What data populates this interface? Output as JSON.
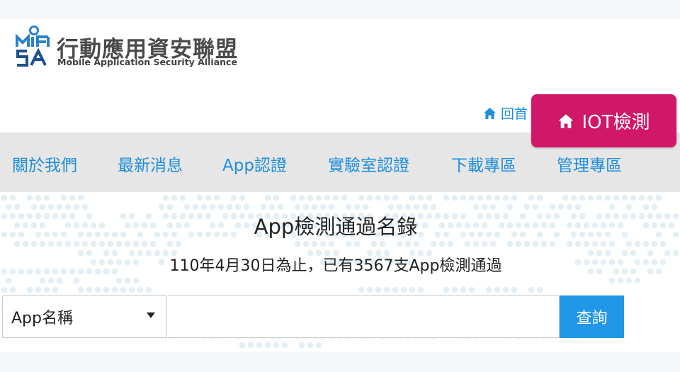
{
  "header": {
    "org_name": "行動應用資安聯盟",
    "org_subtitle": "Mobile Application Security Alliance",
    "home_link": "回首",
    "iot_button": "IOT檢測"
  },
  "nav": {
    "items": [
      {
        "label": "關於我們"
      },
      {
        "label": "最新消息"
      },
      {
        "label": "App認證"
      },
      {
        "label": "實驗室認證"
      },
      {
        "label": "下載專區"
      },
      {
        "label": "管理專區"
      }
    ]
  },
  "main": {
    "title": "App檢測通過名錄",
    "subtitle": "110年4月30日為止，已有3567支App檢測通過"
  },
  "search": {
    "select_value": "App名稱",
    "input_value": "",
    "button_label": "查詢"
  },
  "colors": {
    "brand_blue": "#1f8ed9",
    "iot_pink": "#d01768",
    "nav_bg": "#e6e6e6",
    "search_button": "#2196e6"
  },
  "icons": {
    "home": "home-icon",
    "caret": "caret-down-icon",
    "logo": "misa-logo"
  }
}
